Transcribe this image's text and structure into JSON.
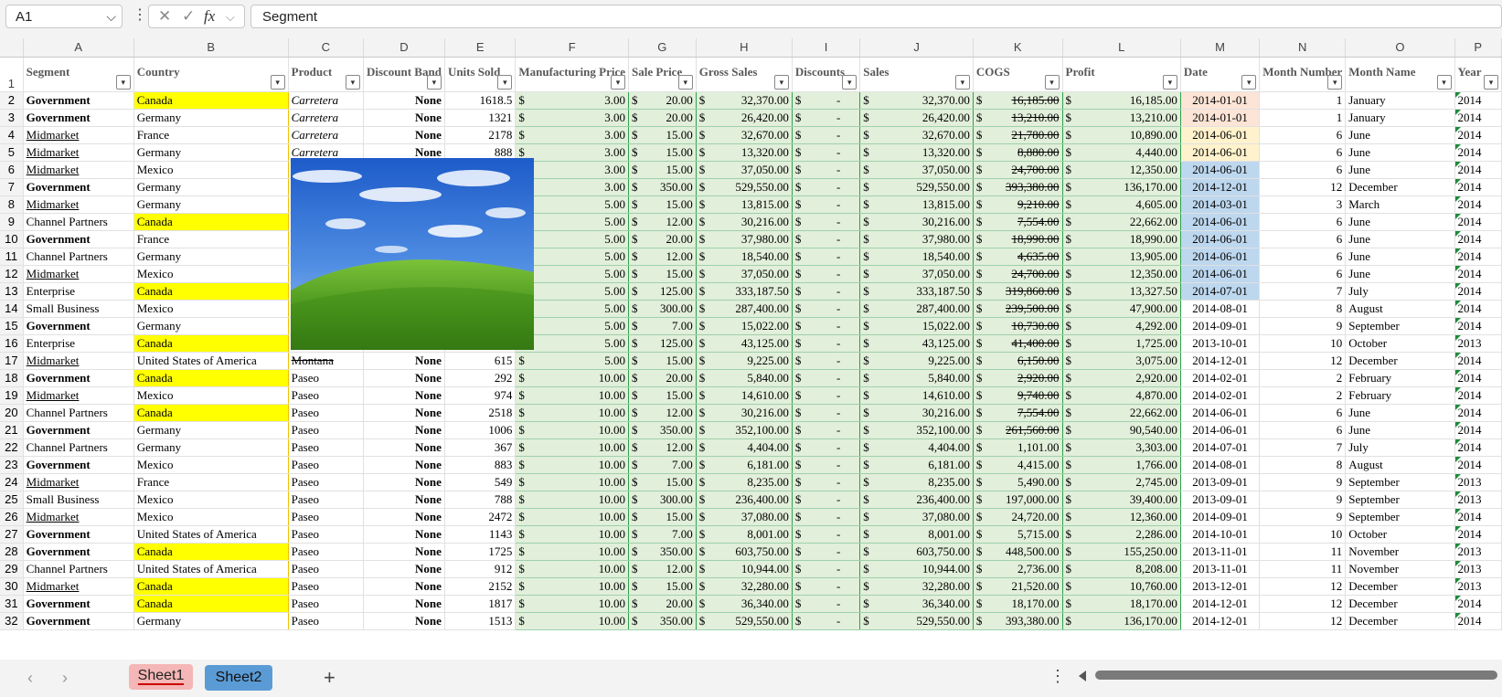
{
  "formula_bar": {
    "cell_ref": "A1",
    "cancel_icon": "✕",
    "enter_icon": "✓",
    "fx_label": "fx",
    "content": "Segment"
  },
  "columns": [
    "A",
    "B",
    "C",
    "D",
    "E",
    "F",
    "G",
    "H",
    "I",
    "J",
    "K",
    "L",
    "M",
    "N",
    "O",
    "P"
  ],
  "headers": [
    "Segment",
    "Country",
    "Product",
    "Discount Band",
    "Units Sold",
    "Manufacturing Price",
    "Sale Price",
    "Gross Sales",
    "Discounts",
    "Sales",
    "COGS",
    "Profit",
    "Date",
    "Month Number",
    "Month Name",
    "Year"
  ],
  "rows": [
    {
      "n": "2",
      "seg": "Government",
      "country": "Canada",
      "product": "Carretera",
      "band": "None",
      "units": "1618.5",
      "mfg": "3.00",
      "price": "20.00",
      "gross": "32,370.00",
      "disc": "-",
      "sales": "32,370.00",
      "cogs": "16,185.00",
      "profit": "16,185.00",
      "date": "2014-01-01",
      "mnum": "1",
      "mname": "January",
      "year": "2014"
    },
    {
      "n": "3",
      "seg": "Government",
      "country": "Germany",
      "product": "Carretera",
      "band": "None",
      "units": "1321",
      "mfg": "3.00",
      "price": "20.00",
      "gross": "26,420.00",
      "disc": "-",
      "sales": "26,420.00",
      "cogs": "13,210.00",
      "profit": "13,210.00",
      "date": "2014-01-01",
      "mnum": "1",
      "mname": "January",
      "year": "2014"
    },
    {
      "n": "4",
      "seg": "Midmarket",
      "country": "France",
      "product": "Carretera",
      "band": "None",
      "units": "2178",
      "mfg": "3.00",
      "price": "15.00",
      "gross": "32,670.00",
      "disc": "-",
      "sales": "32,670.00",
      "cogs": "21,780.00",
      "profit": "10,890.00",
      "date": "2014-06-01",
      "mnum": "6",
      "mname": "June",
      "year": "2014"
    },
    {
      "n": "5",
      "seg": "Midmarket",
      "country": "Germany",
      "product": "Carretera",
      "band": "None",
      "units": "888",
      "mfg": "3.00",
      "price": "15.00",
      "gross": "13,320.00",
      "disc": "-",
      "sales": "13,320.00",
      "cogs": "8,880.00",
      "profit": "4,440.00",
      "date": "2014-06-01",
      "mnum": "6",
      "mname": "June",
      "year": "2014"
    },
    {
      "n": "6",
      "seg": "Midmarket",
      "country": "Mexico",
      "product": "",
      "band": "",
      "units": "",
      "mfg": "3.00",
      "price": "15.00",
      "gross": "37,050.00",
      "disc": "-",
      "sales": "37,050.00",
      "cogs": "24,700.00",
      "profit": "12,350.00",
      "date": "2014-06-01",
      "mnum": "6",
      "mname": "June",
      "year": "2014"
    },
    {
      "n": "7",
      "seg": "Government",
      "country": "Germany",
      "product": "",
      "band": "",
      "units": "",
      "mfg": "3.00",
      "price": "350.00",
      "gross": "529,550.00",
      "disc": "-",
      "sales": "529,550.00",
      "cogs": "393,380.00",
      "profit": "136,170.00",
      "date": "2014-12-01",
      "mnum": "12",
      "mname": "December",
      "year": "2014"
    },
    {
      "n": "8",
      "seg": "Midmarket",
      "country": "Germany",
      "product": "",
      "band": "",
      "units": "",
      "mfg": "5.00",
      "price": "15.00",
      "gross": "13,815.00",
      "disc": "-",
      "sales": "13,815.00",
      "cogs": "9,210.00",
      "profit": "4,605.00",
      "date": "2014-03-01",
      "mnum": "3",
      "mname": "March",
      "year": "2014"
    },
    {
      "n": "9",
      "seg": "Channel Partners",
      "country": "Canada",
      "product": "",
      "band": "",
      "units": "",
      "mfg": "5.00",
      "price": "12.00",
      "gross": "30,216.00",
      "disc": "-",
      "sales": "30,216.00",
      "cogs": "7,554.00",
      "profit": "22,662.00",
      "date": "2014-06-01",
      "mnum": "6",
      "mname": "June",
      "year": "2014"
    },
    {
      "n": "10",
      "seg": "Government",
      "country": "France",
      "product": "",
      "band": "",
      "units": "",
      "mfg": "5.00",
      "price": "20.00",
      "gross": "37,980.00",
      "disc": "-",
      "sales": "37,980.00",
      "cogs": "18,990.00",
      "profit": "18,990.00",
      "date": "2014-06-01",
      "mnum": "6",
      "mname": "June",
      "year": "2014"
    },
    {
      "n": "11",
      "seg": "Channel Partners",
      "country": "Germany",
      "product": "",
      "band": "",
      "units": "",
      "mfg": "5.00",
      "price": "12.00",
      "gross": "18,540.00",
      "disc": "-",
      "sales": "18,540.00",
      "cogs": "4,635.00",
      "profit": "13,905.00",
      "date": "2014-06-01",
      "mnum": "6",
      "mname": "June",
      "year": "2014"
    },
    {
      "n": "12",
      "seg": "Midmarket",
      "country": "Mexico",
      "product": "",
      "band": "",
      "units": "",
      "mfg": "5.00",
      "price": "15.00",
      "gross": "37,050.00",
      "disc": "-",
      "sales": "37,050.00",
      "cogs": "24,700.00",
      "profit": "12,350.00",
      "date": "2014-06-01",
      "mnum": "6",
      "mname": "June",
      "year": "2014"
    },
    {
      "n": "13",
      "seg": "Enterprise",
      "country": "Canada",
      "product": "",
      "band": "",
      "units": "",
      "mfg": "5.00",
      "price": "125.00",
      "gross": "333,187.50",
      "disc": "-",
      "sales": "333,187.50",
      "cogs": "319,860.00",
      "profit": "13,327.50",
      "date": "2014-07-01",
      "mnum": "7",
      "mname": "July",
      "year": "2014"
    },
    {
      "n": "14",
      "seg": "Small Business",
      "country": "Mexico",
      "product": "",
      "band": "",
      "units": "",
      "mfg": "5.00",
      "price": "300.00",
      "gross": "287,400.00",
      "disc": "-",
      "sales": "287,400.00",
      "cogs": "239,500.00",
      "profit": "47,900.00",
      "date": "2014-08-01",
      "mnum": "8",
      "mname": "August",
      "year": "2014"
    },
    {
      "n": "15",
      "seg": "Government",
      "country": "Germany",
      "product": "",
      "band": "",
      "units": "",
      "mfg": "5.00",
      "price": "7.00",
      "gross": "15,022.00",
      "disc": "-",
      "sales": "15,022.00",
      "cogs": "10,730.00",
      "profit": "4,292.00",
      "date": "2014-09-01",
      "mnum": "9",
      "mname": "September",
      "year": "2014"
    },
    {
      "n": "16",
      "seg": "Enterprise",
      "country": "Canada",
      "product": "",
      "band": "",
      "units": "",
      "mfg": "5.00",
      "price": "125.00",
      "gross": "43,125.00",
      "disc": "-",
      "sales": "43,125.00",
      "cogs": "41,400.00",
      "profit": "1,725.00",
      "date": "2013-10-01",
      "mnum": "10",
      "mname": "October",
      "year": "2013"
    },
    {
      "n": "17",
      "seg": "Midmarket",
      "country": "United States of America",
      "product": "Montana",
      "band": "None",
      "units": "615",
      "mfg": "5.00",
      "price": "15.00",
      "gross": "9,225.00",
      "disc": "-",
      "sales": "9,225.00",
      "cogs": "6,150.00",
      "profit": "3,075.00",
      "date": "2014-12-01",
      "mnum": "12",
      "mname": "December",
      "year": "2014"
    },
    {
      "n": "18",
      "seg": "Government",
      "country": "Canada",
      "product": "Paseo",
      "band": "None",
      "units": "292",
      "mfg": "10.00",
      "price": "20.00",
      "gross": "5,840.00",
      "disc": "-",
      "sales": "5,840.00",
      "cogs": "2,920.00",
      "profit": "2,920.00",
      "date": "2014-02-01",
      "mnum": "2",
      "mname": "February",
      "year": "2014"
    },
    {
      "n": "19",
      "seg": "Midmarket",
      "country": "Mexico",
      "product": "Paseo",
      "band": "None",
      "units": "974",
      "mfg": "10.00",
      "price": "15.00",
      "gross": "14,610.00",
      "disc": "-",
      "sales": "14,610.00",
      "cogs": "9,740.00",
      "profit": "4,870.00",
      "date": "2014-02-01",
      "mnum": "2",
      "mname": "February",
      "year": "2014"
    },
    {
      "n": "20",
      "seg": "Channel Partners",
      "country": "Canada",
      "product": "Paseo",
      "band": "None",
      "units": "2518",
      "mfg": "10.00",
      "price": "12.00",
      "gross": "30,216.00",
      "disc": "-",
      "sales": "30,216.00",
      "cogs": "7,554.00",
      "profit": "22,662.00",
      "date": "2014-06-01",
      "mnum": "6",
      "mname": "June",
      "year": "2014"
    },
    {
      "n": "21",
      "seg": "Government",
      "country": "Germany",
      "product": "Paseo",
      "band": "None",
      "units": "1006",
      "mfg": "10.00",
      "price": "350.00",
      "gross": "352,100.00",
      "disc": "-",
      "sales": "352,100.00",
      "cogs": "261,560.00",
      "profit": "90,540.00",
      "date": "2014-06-01",
      "mnum": "6",
      "mname": "June",
      "year": "2014"
    },
    {
      "n": "22",
      "seg": "Channel Partners",
      "country": "Germany",
      "product": "Paseo",
      "band": "None",
      "units": "367",
      "mfg": "10.00",
      "price": "12.00",
      "gross": "4,404.00",
      "disc": "-",
      "sales": "4,404.00",
      "cogs": "1,101.00",
      "profit": "3,303.00",
      "date": "2014-07-01",
      "mnum": "7",
      "mname": "July",
      "year": "2014"
    },
    {
      "n": "23",
      "seg": "Government",
      "country": "Mexico",
      "product": "Paseo",
      "band": "None",
      "units": "883",
      "mfg": "10.00",
      "price": "7.00",
      "gross": "6,181.00",
      "disc": "-",
      "sales": "6,181.00",
      "cogs": "4,415.00",
      "profit": "1,766.00",
      "date": "2014-08-01",
      "mnum": "8",
      "mname": "August",
      "year": "2014"
    },
    {
      "n": "24",
      "seg": "Midmarket",
      "country": "France",
      "product": "Paseo",
      "band": "None",
      "units": "549",
      "mfg": "10.00",
      "price": "15.00",
      "gross": "8,235.00",
      "disc": "-",
      "sales": "8,235.00",
      "cogs": "5,490.00",
      "profit": "2,745.00",
      "date": "2013-09-01",
      "mnum": "9",
      "mname": "September",
      "year": "2013"
    },
    {
      "n": "25",
      "seg": "Small Business",
      "country": "Mexico",
      "product": "Paseo",
      "band": "None",
      "units": "788",
      "mfg": "10.00",
      "price": "300.00",
      "gross": "236,400.00",
      "disc": "-",
      "sales": "236,400.00",
      "cogs": "197,000.00",
      "profit": "39,400.00",
      "date": "2013-09-01",
      "mnum": "9",
      "mname": "September",
      "year": "2013"
    },
    {
      "n": "26",
      "seg": "Midmarket",
      "country": "Mexico",
      "product": "Paseo",
      "band": "None",
      "units": "2472",
      "mfg": "10.00",
      "price": "15.00",
      "gross": "37,080.00",
      "disc": "-",
      "sales": "37,080.00",
      "cogs": "24,720.00",
      "profit": "12,360.00",
      "date": "2014-09-01",
      "mnum": "9",
      "mname": "September",
      "year": "2014"
    },
    {
      "n": "27",
      "seg": "Government",
      "country": "United States of America",
      "product": "Paseo",
      "band": "None",
      "units": "1143",
      "mfg": "10.00",
      "price": "7.00",
      "gross": "8,001.00",
      "disc": "-",
      "sales": "8,001.00",
      "cogs": "5,715.00",
      "profit": "2,286.00",
      "date": "2014-10-01",
      "mnum": "10",
      "mname": "October",
      "year": "2014"
    },
    {
      "n": "28",
      "seg": "Government",
      "country": "Canada",
      "product": "Paseo",
      "band": "None",
      "units": "1725",
      "mfg": "10.00",
      "price": "350.00",
      "gross": "603,750.00",
      "disc": "-",
      "sales": "603,750.00",
      "cogs": "448,500.00",
      "profit": "155,250.00",
      "date": "2013-11-01",
      "mnum": "11",
      "mname": "November",
      "year": "2013"
    },
    {
      "n": "29",
      "seg": "Channel Partners",
      "country": "United States of America",
      "product": "Paseo",
      "band": "None",
      "units": "912",
      "mfg": "10.00",
      "price": "12.00",
      "gross": "10,944.00",
      "disc": "-",
      "sales": "10,944.00",
      "cogs": "2,736.00",
      "profit": "8,208.00",
      "date": "2013-11-01",
      "mnum": "11",
      "mname": "November",
      "year": "2013"
    },
    {
      "n": "30",
      "seg": "Midmarket",
      "country": "Canada",
      "product": "Paseo",
      "band": "None",
      "units": "2152",
      "mfg": "10.00",
      "price": "15.00",
      "gross": "32,280.00",
      "disc": "-",
      "sales": "32,280.00",
      "cogs": "21,520.00",
      "profit": "10,760.00",
      "date": "2013-12-01",
      "mnum": "12",
      "mname": "December",
      "year": "2013"
    },
    {
      "n": "31",
      "seg": "Government",
      "country": "Canada",
      "product": "Paseo",
      "band": "None",
      "units": "1817",
      "mfg": "10.00",
      "price": "20.00",
      "gross": "36,340.00",
      "disc": "-",
      "sales": "36,340.00",
      "cogs": "18,170.00",
      "profit": "18,170.00",
      "date": "2014-12-01",
      "mnum": "12",
      "mname": "December",
      "year": "2014"
    },
    {
      "n": "32",
      "seg": "Government",
      "country": "Germany",
      "product": "Paseo",
      "band": "None",
      "units": "1513",
      "mfg": "10.00",
      "price": "350.00",
      "gross": "529,550.00",
      "disc": "-",
      "sales": "529,550.00",
      "cogs": "393,380.00",
      "profit": "136,170.00",
      "date": "2014-12-01",
      "mnum": "12",
      "mname": "December",
      "year": "2014"
    }
  ],
  "sheets": [
    "Sheet1",
    "Sheet2"
  ],
  "colors": {
    "highlight": "#ffff00",
    "green_fill": "#e2efda",
    "band_red": "#e81010",
    "date_orange": "#fce4d6",
    "date_yellow": "#fff2cc",
    "date_blue": "#bdd7ee",
    "active_tab": "#f4b6b6",
    "second_tab": "#5b9bd5"
  },
  "icons": {
    "name_box": "chevron-down-icon",
    "more": "vertical-dots-icon",
    "add_sheet": "plus-icon",
    "nav_prev": "chevron-left-icon",
    "nav_next": "chevron-right-icon",
    "embedded_image": "landscape-photo"
  }
}
